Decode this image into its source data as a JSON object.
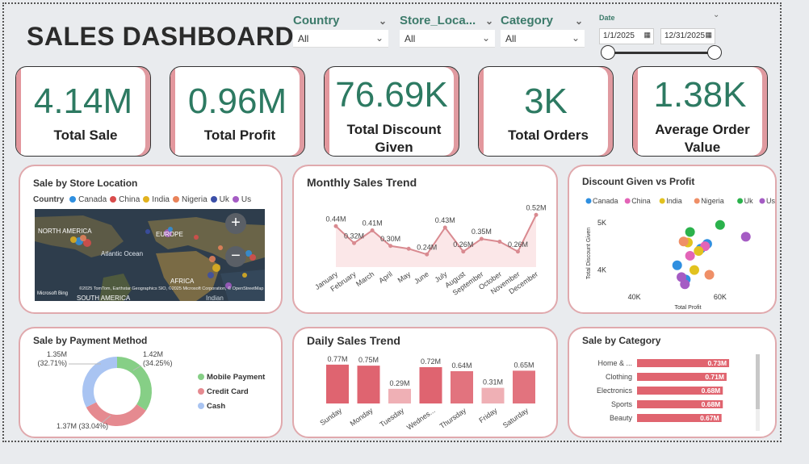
{
  "header": {
    "title": "SALES DASHBOARD"
  },
  "filters": {
    "country": {
      "label": "Country",
      "value": "All"
    },
    "store": {
      "label": "Store_Loca...",
      "value": "All"
    },
    "category": {
      "label": "Category",
      "value": "All"
    },
    "date": {
      "label": "Date",
      "start": "1/1/2025",
      "end": "12/31/2025"
    }
  },
  "kpis": [
    {
      "value": "4.14M",
      "label": "Total Sale"
    },
    {
      "value": "0.96M",
      "label": "Total Profit"
    },
    {
      "value": "76.69K",
      "label": "Total Discount Given"
    },
    {
      "value": "3K",
      "label": "Total Orders"
    },
    {
      "value": "1.38K",
      "label": "Average Order Value"
    }
  ],
  "map": {
    "title": "Sale by Store Location",
    "legend_title": "Country",
    "legend": [
      {
        "name": "Canada",
        "color": "#2f8fe0"
      },
      {
        "name": "China",
        "color": "#d94c4c"
      },
      {
        "name": "India",
        "color": "#e2b21f"
      },
      {
        "name": "Nigeria",
        "color": "#e9835a"
      },
      {
        "name": "Uk",
        "color": "#3b4fa8"
      },
      {
        "name": "Us",
        "color": "#a55cc4"
      }
    ],
    "labels": {
      "na": "NORTH AMERICA",
      "eu": "EUROPE",
      "atl": "Atlantic Ocean",
      "af": "AFRICA",
      "sa": "SOUTH AMERICA",
      "ind": "Indian"
    },
    "attribution": "©2025 TomTom, Earthstar Geographics SIO, ©2025 Microsoft Corporation, © OpenStreetMap",
    "bing": "Microsoft Bing"
  },
  "chart_data": [
    {
      "type": "line",
      "title": "Monthly Sales Trend",
      "categories": [
        "January",
        "February",
        "March",
        "April",
        "May",
        "June",
        "July",
        "August",
        "September",
        "October",
        "November",
        "December"
      ],
      "values": [
        0.44,
        0.32,
        0.41,
        0.3,
        0.28,
        0.24,
        0.43,
        0.26,
        0.35,
        0.33,
        0.26,
        0.52
      ],
      "labels": [
        "0.44M",
        "0.32M",
        "0.41M",
        "0.30M",
        "",
        "0.24M",
        "0.43M",
        "0.26M",
        "0.35M",
        "",
        "0.26M",
        "0.52M"
      ],
      "color": "#d98a90"
    },
    {
      "type": "scatter",
      "title": "Discount Given vs Profit",
      "xlabel": "Total Profit",
      "ylabel": "Total Discount Given",
      "xticks": [
        "40K",
        "60K"
      ],
      "yticks": [
        "4K",
        "5K"
      ],
      "xlim": [
        35000,
        70000
      ],
      "ylim": [
        3500,
        5200
      ],
      "series": [
        {
          "name": "Canada",
          "color": "#2f8fe0",
          "points": [
            [
              50000,
              4100
            ],
            [
              52000,
              3800
            ],
            [
              57000,
              4550
            ],
            [
              55500,
              4450
            ]
          ]
        },
        {
          "name": "China",
          "color": "#e364b7",
          "points": [
            [
              53000,
              4300
            ],
            [
              56500,
              4500
            ]
          ]
        },
        {
          "name": "India",
          "color": "#e2c21f",
          "points": [
            [
              52500,
              4580
            ],
            [
              54000,
              4000
            ],
            [
              55000,
              4400
            ]
          ]
        },
        {
          "name": "Nigeria",
          "color": "#ef8f67",
          "points": [
            [
              51500,
              4600
            ],
            [
              57500,
              3900
            ]
          ]
        },
        {
          "name": "Uk",
          "color": "#2bb24c",
          "points": [
            [
              53000,
              4800
            ],
            [
              60000,
              4950
            ]
          ]
        },
        {
          "name": "Us",
          "color": "#a55cc4",
          "points": [
            [
              51000,
              3850
            ],
            [
              51800,
              3700
            ],
            [
              66000,
              4700
            ]
          ]
        }
      ]
    },
    {
      "type": "pie",
      "title": "Sale by Payment Method",
      "series": [
        {
          "name": "Mobile Payment",
          "value": 1.42,
          "label": "1.42M (34.25%)",
          "color": "#86cf86"
        },
        {
          "name": "Credit Card",
          "value": 1.37,
          "label": "1.37M (33.04%)",
          "color": "#e58a90"
        },
        {
          "name": "Cash",
          "value": 1.35,
          "label": "1.35M (32.71%)",
          "color": "#a9c4f2"
        }
      ]
    },
    {
      "type": "bar",
      "title": "Daily Sales Trend",
      "categories": [
        "Sunday",
        "Monday",
        "Tuesday",
        "Wednes...",
        "Thursday",
        "Friday",
        "Saturday"
      ],
      "values": [
        0.77,
        0.75,
        0.29,
        0.72,
        0.64,
        0.31,
        0.65
      ],
      "labels": [
        "0.77M",
        "0.75M",
        "0.29M",
        "0.72M",
        "0.64M",
        "0.31M",
        "0.65M"
      ],
      "colors": [
        "#df6470",
        "#df6470",
        "#efb0b5",
        "#df6470",
        "#e2737e",
        "#efb0b5",
        "#e2737e"
      ]
    },
    {
      "type": "bar",
      "title": "Sale by Category",
      "categories": [
        "Home & ...",
        "Clothing",
        "Electronics",
        "Sports",
        "Beauty"
      ],
      "values": [
        0.73,
        0.71,
        0.68,
        0.68,
        0.67
      ],
      "labels": [
        "0.73M",
        "0.71M",
        "0.68M",
        "0.68M",
        "0.67M"
      ],
      "color": "#e0646f"
    }
  ]
}
